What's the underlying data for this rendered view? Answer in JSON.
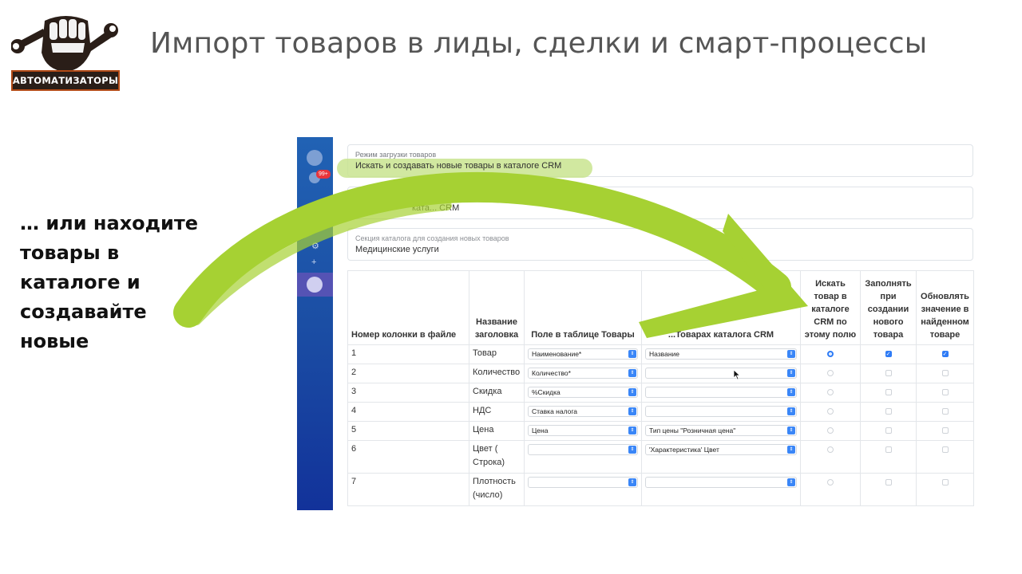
{
  "brand": {
    "logo_text": "АВТОМАТИЗАТОРЫ"
  },
  "slide": {
    "title": "Импорт товаров в лиды, сделки и смарт-процессы",
    "side_lines": [
      "… или находите",
      "товары в",
      "каталоге и",
      "создавайте",
      "новые"
    ]
  },
  "crm": {
    "sidebar": {
      "badge": "99+"
    },
    "mode_field": {
      "label": "Режим загрузки товаров",
      "value": "Искать и создавать новые товары в каталоге CRM"
    },
    "catalog_field": {
      "label": "К",
      "value": "ката... СRM"
    },
    "section_field": {
      "label": "Секция каталога для создания новых товаров",
      "value": "Медицинские услуги"
    },
    "table": {
      "headers": [
        "Номер колонки в файле",
        "Название заголовка",
        "Поле в таблице Товары",
        "...Товарах каталога CRM",
        "Искать товар в каталоге CRM по этому полю",
        "Заполнять при создании нового товара",
        "Обновлять значение в найденном товаре"
      ],
      "rows": [
        {
          "num": "1",
          "name": "Товар",
          "field": "Наименование*",
          "catalog": "Название",
          "search": true,
          "fill": true,
          "update": true
        },
        {
          "num": "2",
          "name": "Количество",
          "field": "Количество*",
          "catalog": "",
          "search": false,
          "fill": false,
          "update": false
        },
        {
          "num": "3",
          "name": "Скидка",
          "field": "%Скидка",
          "catalog": "",
          "search": false,
          "fill": false,
          "update": false
        },
        {
          "num": "4",
          "name": "НДС",
          "field": "Ставка налога",
          "catalog": "",
          "search": false,
          "fill": false,
          "update": false
        },
        {
          "num": "5",
          "name": "Цена",
          "field": "Цена",
          "catalog": "Тип цены \"Розничная цена\"",
          "search": false,
          "fill": false,
          "update": false
        },
        {
          "num": "6",
          "name": "Цвет ( Строка)",
          "field": "",
          "catalog": "'Характеристика' Цвет",
          "search": false,
          "fill": false,
          "update": false
        },
        {
          "num": "7",
          "name": "Плотность (число)",
          "field": "",
          "catalog": "",
          "search": false,
          "fill": false,
          "update": false
        }
      ]
    }
  },
  "colors": {
    "arrow": "#a6d133",
    "highlight": "#c9e48f",
    "sidebar": "#1b4ea4",
    "accent": "#2f7cf6",
    "title": "#555555"
  }
}
